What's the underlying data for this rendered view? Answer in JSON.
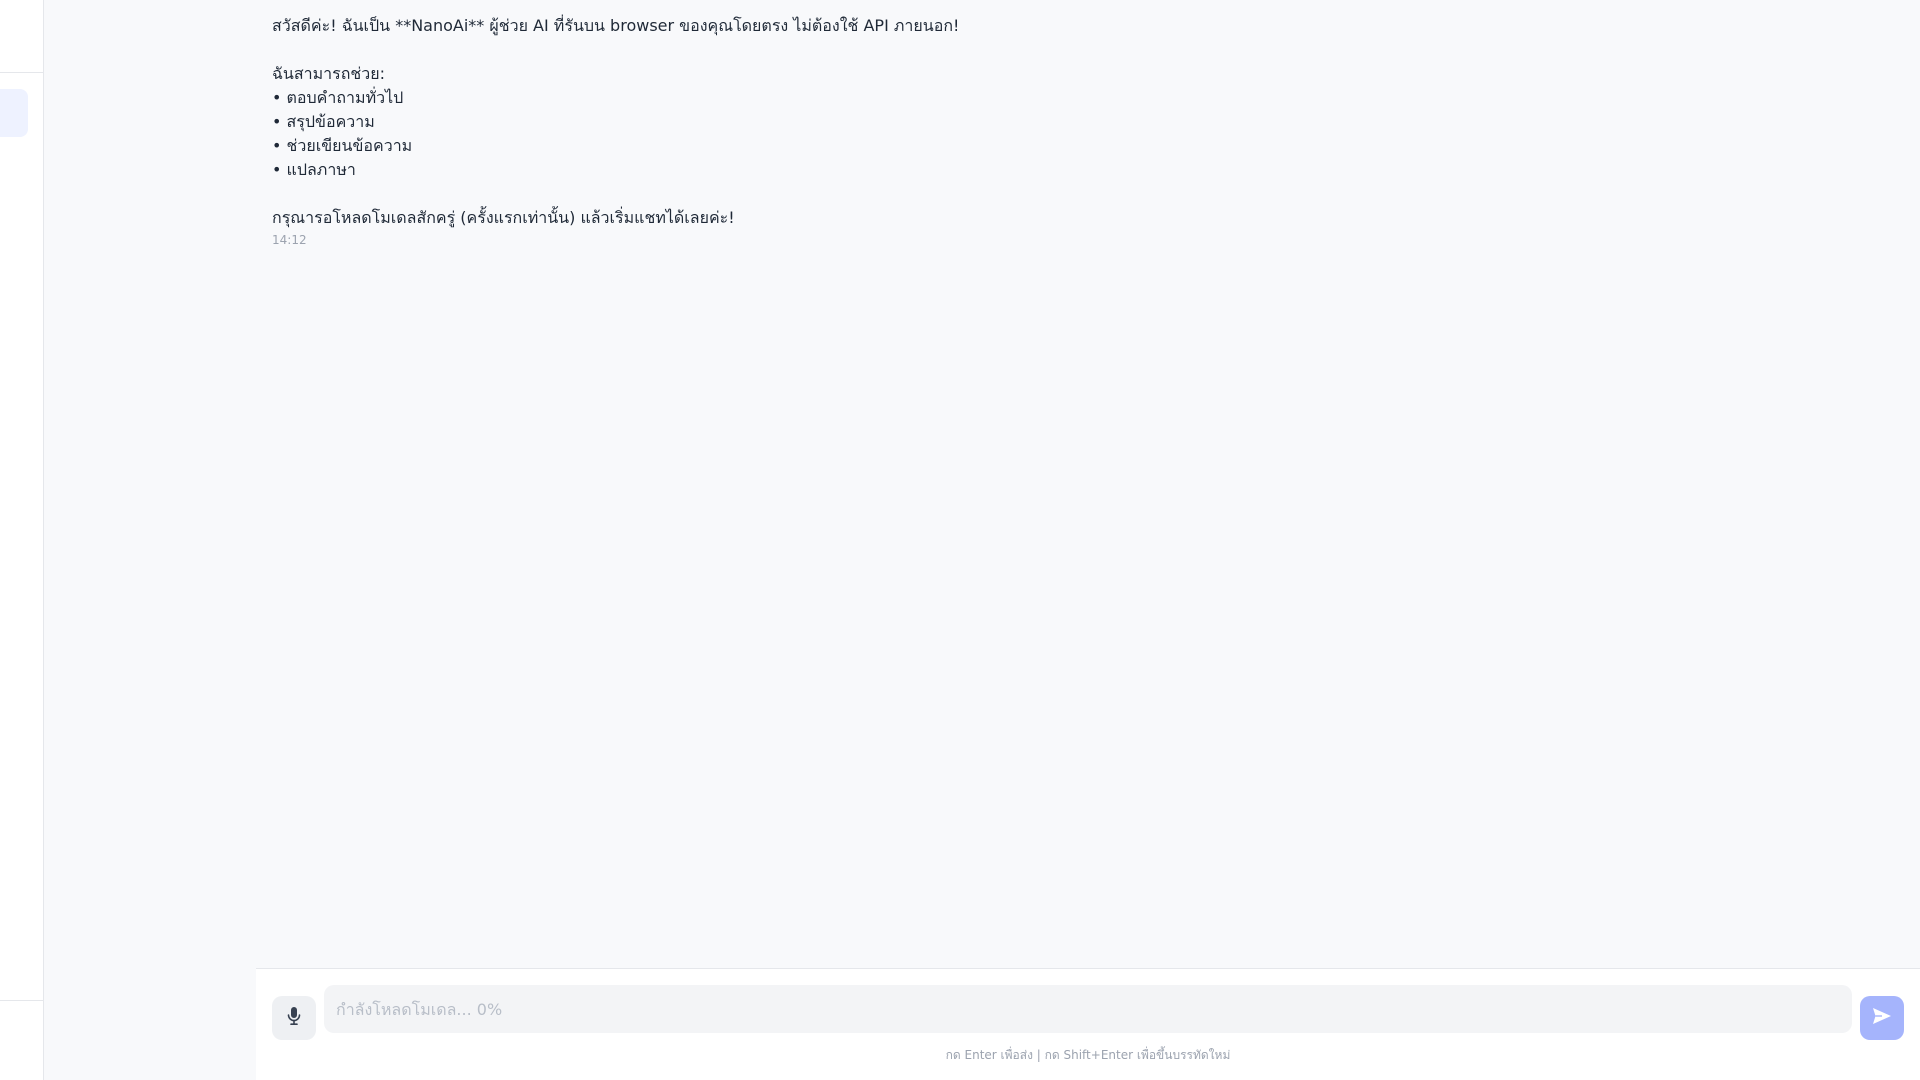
{
  "message": {
    "lines": [
      "สวัสดีค่ะ! ฉันเป็น **NanoAi** ผู้ช่วย AI ที่รันบน browser ของคุณโดยตรง ไม่ต้องใช้ API ภายนอก!",
      "",
      "ฉันสามารถช่วย:",
      "• ตอบคำถามทั่วไป",
      "• สรุปข้อความ",
      "• ช่วยเขียนข้อความ",
      "• แปลภาษา",
      "",
      "กรุณารอโหลดโมเดลสักครู่ (ครั้งแรกเท่านั้น) แล้วเริ่มแชทได้เลยค่ะ!"
    ],
    "time": "14:12"
  },
  "composer": {
    "placeholder": "กำลังโหลดโมเดล... 0%",
    "hint": "กด Enter เพื่อส่ง | กด Shift+Enter เพื่อขึ้นบรรทัดใหม่",
    "mic_icon": "microphone-icon",
    "send_icon": "send-icon"
  },
  "colors": {
    "accent": "#a5b4fc",
    "background": "#f8f9fb"
  }
}
